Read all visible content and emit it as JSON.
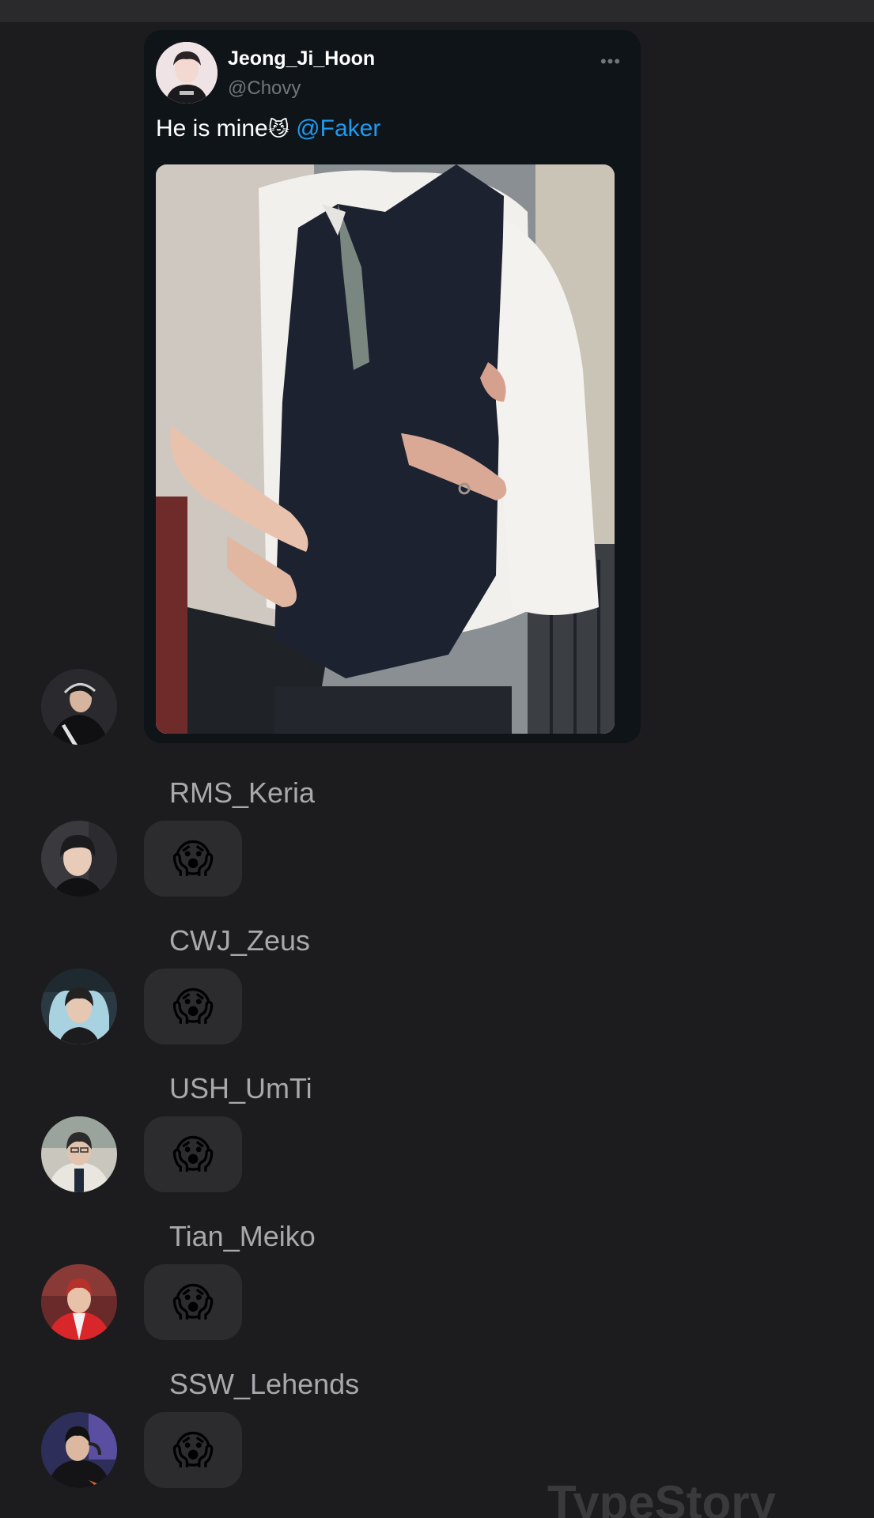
{
  "tweet": {
    "display_name": "Jeong_Ji_Hoon",
    "handle": "@Chovy",
    "more_icon": "more-horizontal-icon",
    "text": "He is mine",
    "emoji": "😼",
    "mention": "@Faker",
    "photo_alt": "Photo of two people in white shirts and dark vests"
  },
  "messages": [
    {
      "sender": "RMS_Keria",
      "reaction": "😱"
    },
    {
      "sender": "CWJ_Zeus",
      "reaction": "😱"
    },
    {
      "sender": "USH_UmTi",
      "reaction": "😱"
    },
    {
      "sender": "Tian_Meiko",
      "reaction": "😱"
    },
    {
      "sender": "SSW_Lehends",
      "reaction": "😱"
    }
  ],
  "watermark": "TypeStory",
  "colors": {
    "background": "#1c1c1e",
    "bubble": "#2c2c2e",
    "tweet_card": "#0f1419",
    "mention": "#1d9bf0",
    "sender_name": "#a8a8ad"
  }
}
